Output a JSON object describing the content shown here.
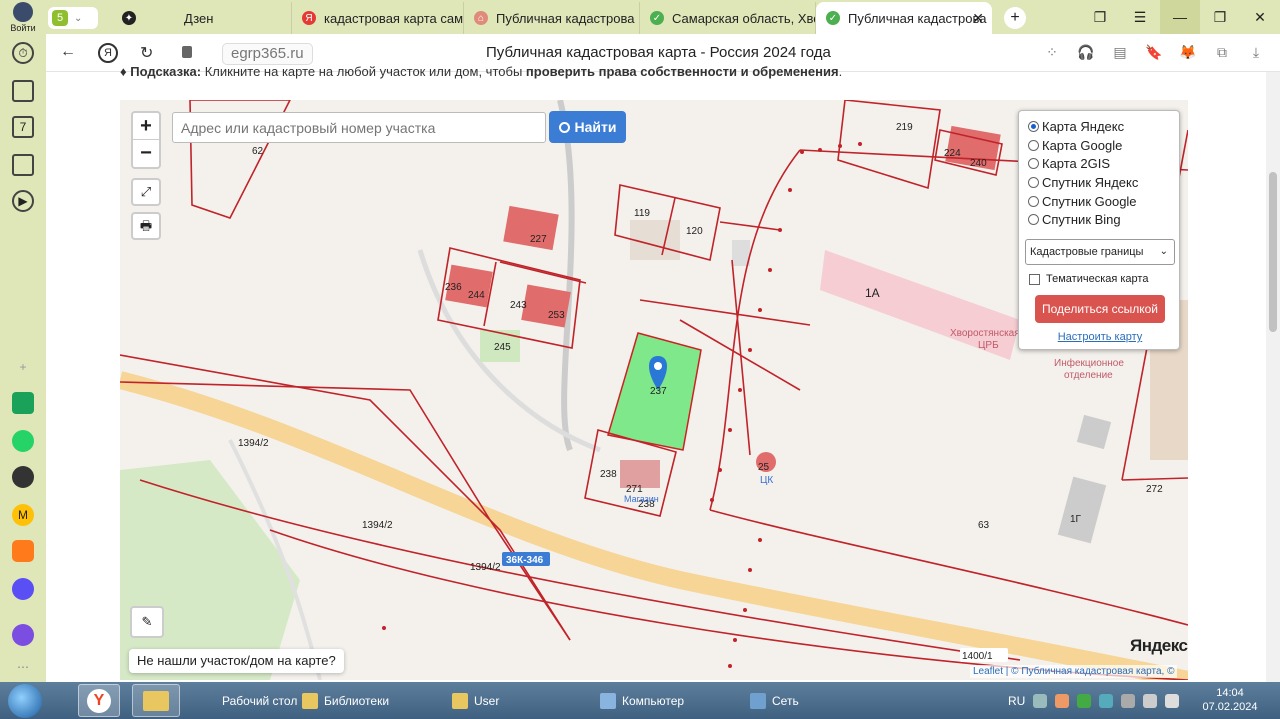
{
  "browser": {
    "login_label": "Войти",
    "tab_count": "5",
    "tabs": [
      {
        "label": "Дзен",
        "color": "#222222",
        "glyph": "✦"
      },
      {
        "label": "кадастровая карта сама",
        "color": "#e53935",
        "glyph": "Я"
      },
      {
        "label": "Публичная кадастрова",
        "color": "#e08a7a",
        "glyph": "⌂"
      },
      {
        "label": "Самарская область, Хво",
        "color": "#4caf50",
        "glyph": "✓"
      },
      {
        "label": "Публичная кадастрова",
        "color": "#4caf50",
        "glyph": "✓"
      }
    ],
    "new_tab": "+",
    "domain": "egrp365.ru",
    "page_title": "Публичная кадастровая карта - Россия 2024 года"
  },
  "hint": {
    "prefix": "Подсказка:",
    "text": " Кликните на карте на любой участок или дом, чтобы ",
    "bold": "проверить права собственности и обременения",
    "suffix": "."
  },
  "map": {
    "zoom_in": "+",
    "zoom_out": "−",
    "fullscreen": "⤢",
    "print": "🖶",
    "search_placeholder": "Адрес или кадастровый номер участка",
    "find_label": "Найти",
    "layers": {
      "options": [
        {
          "label": "Карта Яндекс",
          "checked": true
        },
        {
          "label": "Карта Google",
          "checked": false
        },
        {
          "label": "Карта 2GIS",
          "checked": false
        },
        {
          "label": "Спутник Яндекс",
          "checked": false
        },
        {
          "label": "Спутник Google",
          "checked": false
        },
        {
          "label": "Спутник Bing",
          "checked": false
        }
      ],
      "select_value": "Кадастровые границы",
      "thematic_label": "Тематическая карта",
      "share_label": "Поделиться ссылкой",
      "setup_label": "Настроить карту"
    },
    "draw_icon": "✎",
    "not_found_label": "Не нашли участок/дом на карте?",
    "yandex_logo": "Яндекс",
    "attribution": "Leaflet | © Публичная кадастровая карта, ©",
    "labels": {
      "l62": "62",
      "l219": "219",
      "l224": "224",
      "l240": "240",
      "l119": "119",
      "l120": "120",
      "l227": "227",
      "l236": "236",
      "l244": "244",
      "l243": "243",
      "l253": "253",
      "l245": "245",
      "l237": "237",
      "l238": "238",
      "l271": "271",
      "l238b": "238",
      "l1a": "1А",
      "hosp": "Хворостянская",
      "crb": "ЦРБ",
      "inf1": "Инфекционное",
      "inf2": "отделение",
      "l25": "25",
      "ck": "ЦК",
      "l63": "63",
      "l1g": "1Г",
      "l272": "272",
      "l1394a": "1394/2",
      "l1394b": "1394/2",
      "l1394c": "1394/2",
      "road": "36К-346",
      "l1400": "1400/1",
      "pmkad": "Магазин"
    }
  },
  "taskbar": {
    "desktop": "Рабочий стол",
    "items": [
      {
        "label": "Библиотеки"
      },
      {
        "label": "User"
      },
      {
        "label": "Компьютер"
      },
      {
        "label": "Сеть"
      }
    ],
    "lang": "RU",
    "time": "14:04",
    "date": "07.02.2024"
  }
}
